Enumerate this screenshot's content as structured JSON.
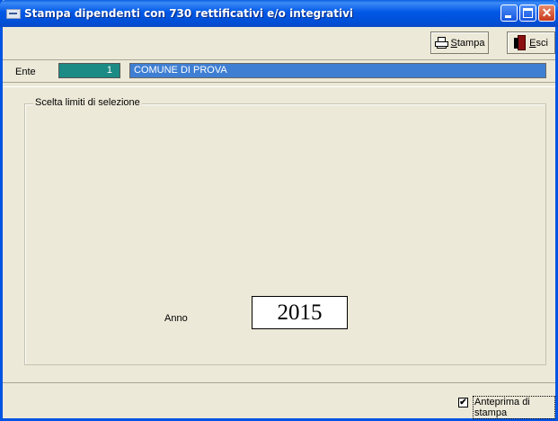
{
  "window": {
    "title": "Stampa dipendenti con 730 rettificativi e/o integrativi"
  },
  "toolbar": {
    "stampa_label_mnemonic": "S",
    "stampa_label_rest": "tampa",
    "esci_label_mnemonic": "E",
    "esci_label_rest": "sci"
  },
  "ente": {
    "label": "Ente",
    "code": "1",
    "name": "COMUNE DI PROVA"
  },
  "selection": {
    "group_title": "Scelta limiti di selezione",
    "anno_label": "Anno",
    "anno_value": "2015"
  },
  "status": {
    "anteprima_label": "Anteprima di stampa",
    "anteprima_checked": true,
    "check_glyph": "✔"
  },
  "icons": {
    "close_glyph": "✕"
  },
  "colors": {
    "titlebar": "#0058e6",
    "ente_code_bg": "#1c8a85",
    "ente_name_bg": "#3f7fd3",
    "window_bg": "#ece9d8"
  }
}
